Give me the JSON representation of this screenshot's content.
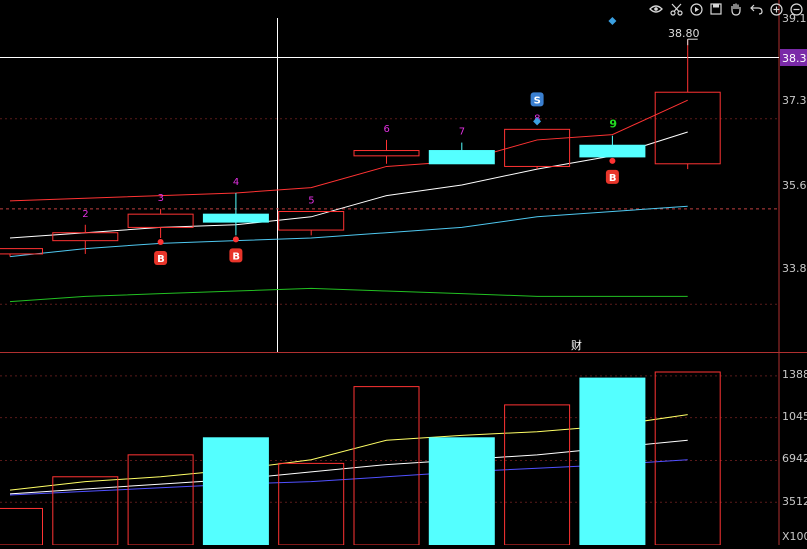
{
  "toolbar": {
    "icons": [
      "eye-icon",
      "scissors-icon",
      "play-circle-icon",
      "save-icon",
      "hand-icon",
      "undo-icon",
      "zoom-in-icon",
      "zoom-out-icon"
    ]
  },
  "colors": {
    "background": "#000000",
    "up": "#ff3333",
    "down_fill": "#54ffff",
    "axis_label": "#c8c8c8",
    "cursor_price_bg": "#7a2aa8",
    "ma_red": "#ff3333",
    "ma_white": "#ffffff",
    "ma_cyan": "#4fc8f0",
    "ma_green": "#22c022",
    "vol_yellow": "#ffff66",
    "vol_white": "#ffffff",
    "vol_blue": "#5050ff",
    "seq_magenta": "#e030e0",
    "seq_nine": "#22dd22"
  },
  "price_axis": {
    "labels": [
      "39.1",
      "37.3",
      "35.6",
      "33.8"
    ],
    "cursor_price": "38.3"
  },
  "volume_axis": {
    "labels": [
      "1388",
      "1045",
      "6942",
      "3512"
    ],
    "unit_label": "X100"
  },
  "annotations": {
    "high_label": "38.80",
    "buy_signal": "B",
    "sell_signal": "S",
    "finance_marker": "财"
  },
  "chart_data": {
    "type": "candlestick",
    "price_range": [
      32.9,
      39.2
    ],
    "volume_range": [
      0,
      1420
    ],
    "candles": [
      {
        "label": "",
        "open": 34.75,
        "close": 34.85,
        "high": 34.85,
        "low": 34.7,
        "volume": 300,
        "color": "up",
        "buy": false
      },
      {
        "label": "2",
        "open": 35.0,
        "close": 35.15,
        "high": 35.3,
        "low": 34.75,
        "volume": 560,
        "color": "up",
        "buy": false
      },
      {
        "label": "3",
        "open": 35.25,
        "close": 35.5,
        "high": 35.6,
        "low": 35.05,
        "volume": 740,
        "color": "up",
        "buy": true
      },
      {
        "label": "4",
        "open": 35.5,
        "close": 35.35,
        "high": 35.9,
        "low": 35.1,
        "volume": 880,
        "color": "down",
        "buy": true
      },
      {
        "label": "5",
        "open": 35.2,
        "close": 35.55,
        "high": 35.55,
        "low": 35.1,
        "volume": 670,
        "color": "up",
        "buy": false
      },
      {
        "label": "6",
        "open": 36.6,
        "close": 36.7,
        "high": 36.9,
        "low": 36.45,
        "volume": 1300,
        "color": "up",
        "buy": false
      },
      {
        "label": "7",
        "open": 36.7,
        "close": 36.45,
        "high": 36.85,
        "low": 36.45,
        "volume": 880,
        "color": "down",
        "buy": false
      },
      {
        "label": "8",
        "open": 36.4,
        "close": 37.1,
        "high": 37.1,
        "low": 36.35,
        "volume": 1150,
        "color": "up",
        "buy": false
      },
      {
        "label": "9",
        "open": 36.8,
        "close": 36.58,
        "high": 36.98,
        "low": 36.58,
        "volume": 1370,
        "color": "down",
        "buy": true
      },
      {
        "label": "",
        "open": 36.45,
        "close": 37.8,
        "high": 38.8,
        "low": 36.35,
        "volume": 1420,
        "color": "up",
        "buy": false
      }
    ],
    "ma_price": [
      {
        "name": "",
        "color": "ma_red",
        "values": [
          35.75,
          35.8,
          35.85,
          35.9,
          36.0,
          36.4,
          36.5,
          36.9,
          37.0,
          37.65
        ]
      },
      {
        "name": "",
        "color": "ma_white",
        "values": [
          35.05,
          35.15,
          35.25,
          35.3,
          35.45,
          35.85,
          36.05,
          36.35,
          36.6,
          37.05
        ]
      },
      {
        "name": "",
        "color": "ma_cyan",
        "values": [
          34.7,
          34.85,
          34.95,
          35.0,
          35.05,
          35.15,
          35.25,
          35.45,
          35.55,
          35.65
        ]
      },
      {
        "name": "",
        "color": "ma_green",
        "values": [
          33.85,
          33.95,
          34.0,
          34.05,
          34.1,
          34.05,
          34.0,
          33.95,
          33.95,
          33.95
        ]
      }
    ],
    "ma_volume": [
      {
        "name": "",
        "color": "vol_yellow",
        "values": [
          450,
          520,
          560,
          620,
          700,
          860,
          900,
          930,
          980,
          1070
        ]
      },
      {
        "name": "",
        "color": "vol_white",
        "values": [
          420,
          460,
          500,
          540,
          600,
          660,
          700,
          740,
          800,
          860
        ]
      },
      {
        "name": "",
        "color": "vol_blue",
        "values": [
          410,
          440,
          470,
          500,
          520,
          560,
          600,
          630,
          660,
          700
        ]
      }
    ]
  }
}
